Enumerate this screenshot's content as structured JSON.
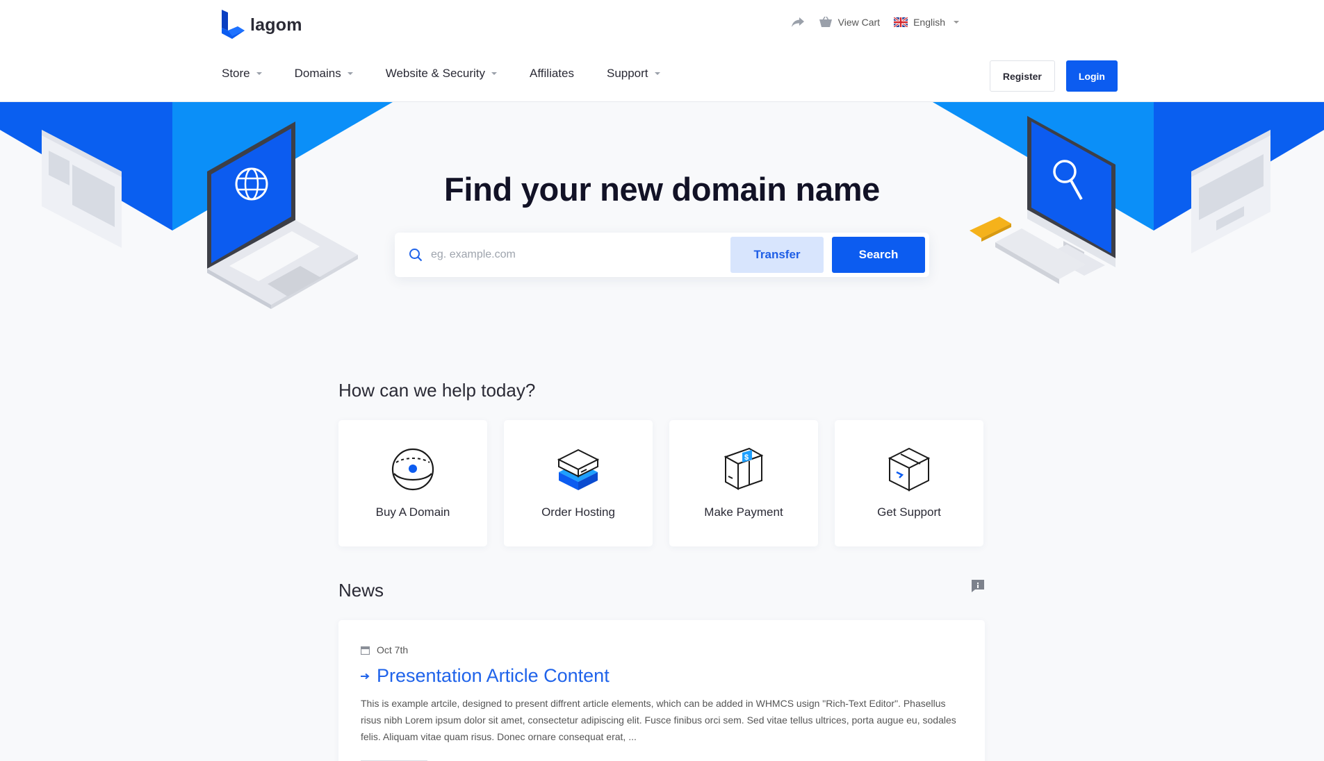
{
  "brand": {
    "name": "lagom",
    "accent": "#0c5cf0",
    "accent_light": "#d8e5fd"
  },
  "topbar": {
    "share_icon": "share-arrow-icon",
    "cart_label": "View Cart",
    "cart_icon": "basket-icon",
    "language_label": "English",
    "language_icon": "uk-flag-icon"
  },
  "nav": {
    "items": [
      {
        "label": "Store",
        "dropdown": true
      },
      {
        "label": "Domains",
        "dropdown": true
      },
      {
        "label": "Website & Security",
        "dropdown": true
      },
      {
        "label": "Affiliates",
        "dropdown": false
      },
      {
        "label": "Support",
        "dropdown": true
      }
    ]
  },
  "auth": {
    "register_label": "Register",
    "login_label": "Login"
  },
  "hero": {
    "title": "Find your new domain name",
    "search_placeholder": "eg. example.com",
    "transfer_label": "Transfer",
    "search_label": "Search"
  },
  "help": {
    "title": "How can we help today?",
    "cards": [
      {
        "label": "Buy A Domain",
        "icon": "domain-globe-icon"
      },
      {
        "label": "Order Hosting",
        "icon": "hosting-server-icon"
      },
      {
        "label": "Make Payment",
        "icon": "payment-box-icon"
      },
      {
        "label": "Get Support",
        "icon": "support-box-icon"
      }
    ]
  },
  "news": {
    "title": "News",
    "feed_icon": "feed-icon",
    "items": [
      {
        "date": "Oct 7th",
        "title": "Presentation Article Content",
        "excerpt": "This is example artcile, designed to present diffrent article elements, which can be added in WHMCS usign \"Rich-Text Editor\". Phasellus risus nibh Lorem ipsum dolor sit amet, consectetur adipiscing elit. Fusce finibus orci sem. Sed vitae tellus ultrices, porta augue eu, sodales felis. Aliquam vitae quam risus. Donec ornare consequat erat, ..."
      }
    ]
  }
}
